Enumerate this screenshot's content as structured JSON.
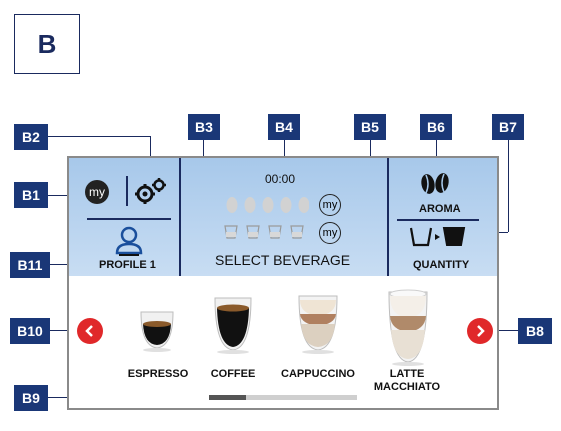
{
  "figure_label": "B",
  "callouts": {
    "b1": "B1",
    "b2": "B2",
    "b3": "B3",
    "b4": "B4",
    "b5": "B5",
    "b6": "B6",
    "b7": "B7",
    "b8": "B8",
    "b9": "B9",
    "b10": "B10",
    "b11": "B11"
  },
  "screen": {
    "my_badge": "my",
    "profile_label": "PROFILE 1",
    "time": "00:00",
    "strength_my": "my",
    "quantity_my": "my",
    "status": "SELECT BEVERAGE",
    "aroma_label": "AROMA",
    "quantity_label": "QUANTITY",
    "beverages": [
      {
        "label": "ESPRESSO"
      },
      {
        "label": "COFFEE"
      },
      {
        "label": "CAPPUCCINO"
      },
      {
        "label": "LATTE\nMACCHIATO"
      }
    ],
    "page_progress": 0.25
  },
  "colors": {
    "accent": "#1a3777",
    "nav": "#e0282a",
    "panel": "#b6d2ef"
  }
}
